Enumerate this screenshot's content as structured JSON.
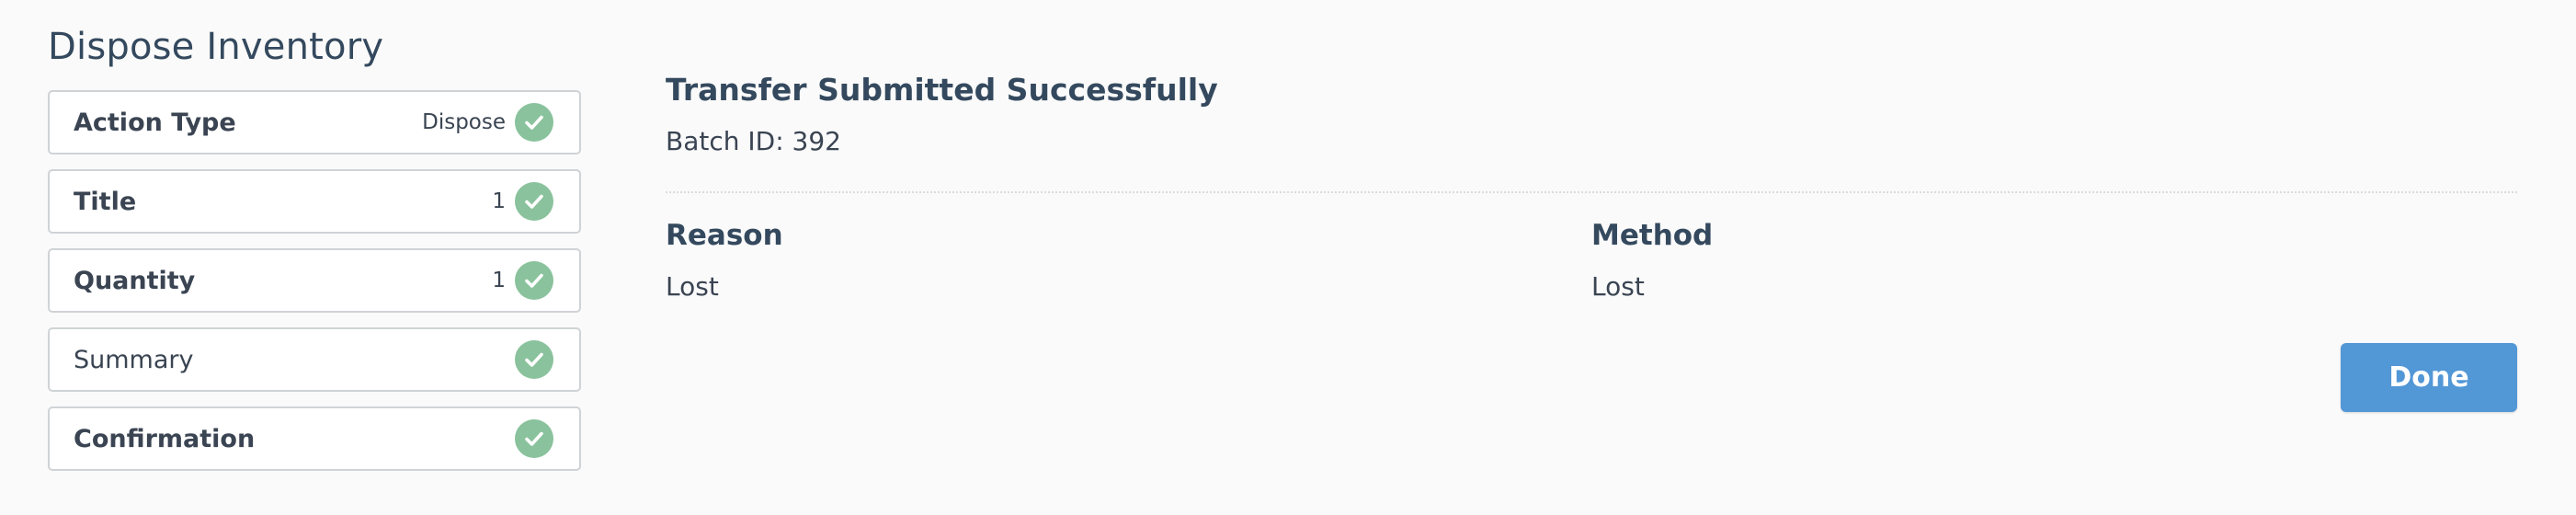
{
  "page": {
    "title": "Dispose Inventory"
  },
  "steps": [
    {
      "label": "Action Type",
      "value": "Dispose",
      "status": "complete",
      "icon": "check-circle-icon"
    },
    {
      "label": "Title",
      "value": "1",
      "status": "complete",
      "icon": "check-circle-icon"
    },
    {
      "label": "Quantity",
      "value": "1",
      "status": "complete",
      "icon": "check-circle-icon"
    },
    {
      "label": "Summary",
      "value": "",
      "status": "complete",
      "icon": "check-circle-icon"
    },
    {
      "label": "Confirmation",
      "value": "",
      "status": "complete",
      "icon": "check-circle-icon"
    }
  ],
  "result": {
    "title": "Transfer Submitted Successfully",
    "batch_text": "Batch ID: 392",
    "reason_label": "Reason",
    "reason_value": "Lost",
    "method_label": "Method",
    "method_value": "Lost"
  },
  "actions": {
    "done_label": "Done"
  },
  "colors": {
    "accent": "#5297d6",
    "success": "#89c29c",
    "text": "#34495e",
    "border": "#cfd3d6",
    "background": "#fafafa"
  }
}
